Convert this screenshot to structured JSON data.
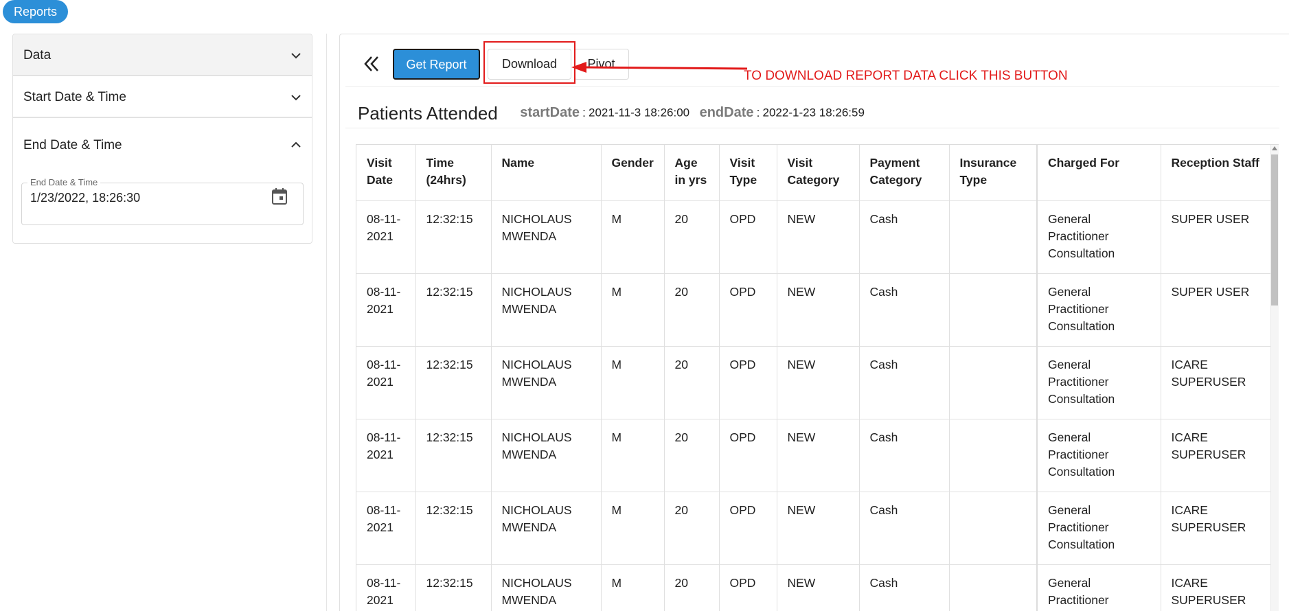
{
  "header": {
    "reports_label": "Reports"
  },
  "sidebar": {
    "sections": [
      {
        "label": "Data",
        "state": "collapsed"
      },
      {
        "label": "Start Date & Time",
        "state": "collapsed"
      },
      {
        "label": "End Date & Time",
        "state": "expanded"
      }
    ],
    "end_field": {
      "label": "End Date & Time",
      "value": "1/23/2022, 18:26:30"
    }
  },
  "toolbar": {
    "get_report_label": "Get Report",
    "download_label": "Download",
    "pivot_label": "Pivot"
  },
  "annotation": {
    "text": "TO DOWNLOAD REPORT DATA CLICK THIS BUTTON",
    "color": "#e21a1a"
  },
  "report": {
    "title": "Patients Attended",
    "start_key": "startDate",
    "start_value": "2021-11-3 18:26:00",
    "end_key": "endDate",
    "end_value": "2022-1-23 18:26:59",
    "sep": ":"
  },
  "table": {
    "columns": [
      "Visit Date",
      "Time (24hrs)",
      "Name",
      "Gender",
      "Age in yrs",
      "Visit Type",
      "Visit Category",
      "Payment Category",
      "Insurance Type",
      "Charged For",
      "Reception Staff"
    ],
    "rows": [
      [
        "08-11-2021",
        "12:32:15",
        "NICHOLAUS MWENDA",
        "M",
        "20",
        "OPD",
        "NEW",
        "Cash",
        "",
        "General Practitioner Consultation",
        "SUPER USER"
      ],
      [
        "08-11-2021",
        "12:32:15",
        "NICHOLAUS MWENDA",
        "M",
        "20",
        "OPD",
        "NEW",
        "Cash",
        "",
        "General Practitioner Consultation",
        "SUPER USER"
      ],
      [
        "08-11-2021",
        "12:32:15",
        "NICHOLAUS MWENDA",
        "M",
        "20",
        "OPD",
        "NEW",
        "Cash",
        "",
        "General Practitioner Consultation",
        "ICARE SUPERUSER"
      ],
      [
        "08-11-2021",
        "12:32:15",
        "NICHOLAUS MWENDA",
        "M",
        "20",
        "OPD",
        "NEW",
        "Cash",
        "",
        "General Practitioner Consultation",
        "ICARE SUPERUSER"
      ],
      [
        "08-11-2021",
        "12:32:15",
        "NICHOLAUS MWENDA",
        "M",
        "20",
        "OPD",
        "NEW",
        "Cash",
        "",
        "General Practitioner Consultation",
        "ICARE SUPERUSER"
      ],
      [
        "08-11-2021",
        "12:32:15",
        "NICHOLAUS MWENDA",
        "M",
        "20",
        "OPD",
        "NEW",
        "Cash",
        "",
        "General Practitioner Consultation",
        "ICARE SUPERUSER"
      ]
    ]
  },
  "colors": {
    "primary": "#2c8fd8",
    "annotation": "#e21a1a"
  }
}
